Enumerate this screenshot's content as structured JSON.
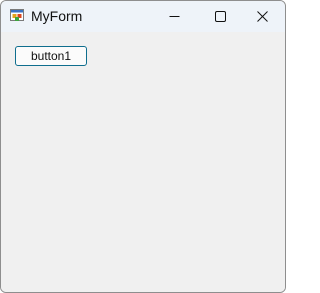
{
  "window": {
    "title": "MyForm",
    "app_icon": "form-icon",
    "controls": {
      "minimize_icon": "minimize-icon",
      "maximize_icon": "maximize-icon",
      "close_icon": "close-icon"
    }
  },
  "form": {
    "button1_label": "button1"
  }
}
